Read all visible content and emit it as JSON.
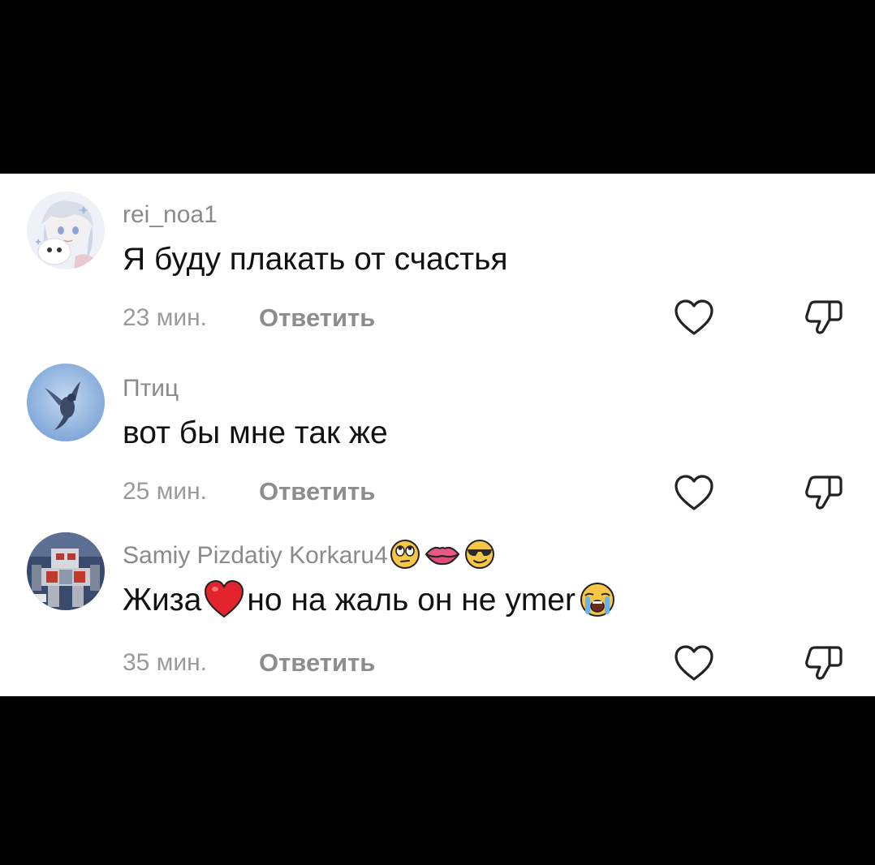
{
  "comments": [
    {
      "username": "rei_noa1",
      "text": "Я буду плакать от счастья",
      "time": "23 мин.",
      "reply_label": "Ответить",
      "avatar_icon": "anime-girl-avatar"
    },
    {
      "username": "Птиц",
      "text": "вот бы мне так же",
      "time": "25 мин.",
      "reply_label": "Ответить",
      "avatar_icon": "bird-avatar"
    },
    {
      "username": "Samiy Pizdatiy Korkaru4",
      "username_emojis": [
        "eye-roll-emoji",
        "lips-emoji",
        "sunglasses-emoji"
      ],
      "text_part1": "Жиза",
      "text_emoji1": "red-heart-emoji",
      "text_part2": "но на жаль он не ymer",
      "text_emoji2": "crying-face-emoji",
      "time": "35 мин.",
      "reply_label": "Ответить",
      "avatar_icon": "robot-avatar"
    }
  ],
  "icons": {
    "like": "heart-outline-icon",
    "dislike": "thumbs-down-icon"
  },
  "colors": {
    "background": "#000000",
    "panel": "#ffffff",
    "username": "#8a8a8a",
    "text": "#111111",
    "meta": "#9a9a9a"
  }
}
